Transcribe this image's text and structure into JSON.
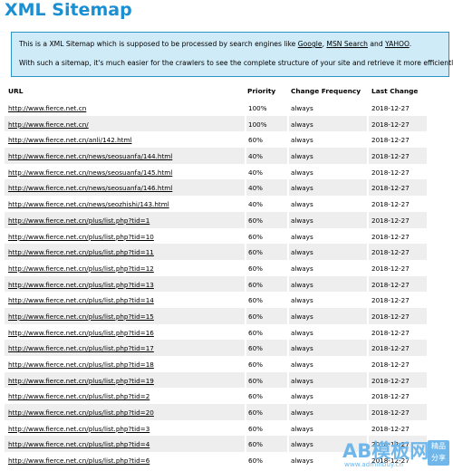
{
  "page": {
    "title": "XML Sitemap"
  },
  "intro": {
    "line1_prefix": "This is a XML Sitemap which is supposed to be processed by search engines like ",
    "link_google": "Google",
    "sep1": ", ",
    "link_msn": "MSN Search",
    "sep2": " and ",
    "link_yahoo": "YAHOO",
    "line1_suffix": ".",
    "line2": "With such a sitemap, it's much easier for the crawlers to see the complete structure of your site and retrieve it more efficiently."
  },
  "table": {
    "headers": {
      "url": "URL",
      "priority": "Priority",
      "frequency": "Change Frequency",
      "modified": "Last Change"
    },
    "rows": [
      {
        "url": "http://www.fierce.net.cn",
        "priority": "100%",
        "frequency": "always",
        "modified": "2018-12-27"
      },
      {
        "url": "http://www.fierce.net.cn/",
        "priority": "100%",
        "frequency": "always",
        "modified": "2018-12-27"
      },
      {
        "url": "http://www.fierce.net.cn/anli/142.html",
        "priority": "60%",
        "frequency": "always",
        "modified": "2018-12-27"
      },
      {
        "url": "http://www.fierce.net.cn/news/seosuanfa/144.html",
        "priority": "40%",
        "frequency": "always",
        "modified": "2018-12-27"
      },
      {
        "url": "http://www.fierce.net.cn/news/seosuanfa/145.html",
        "priority": "40%",
        "frequency": "always",
        "modified": "2018-12-27"
      },
      {
        "url": "http://www.fierce.net.cn/news/seosuanfa/146.html",
        "priority": "40%",
        "frequency": "always",
        "modified": "2018-12-27"
      },
      {
        "url": "http://www.fierce.net.cn/news/seozhishi/143.html",
        "priority": "40%",
        "frequency": "always",
        "modified": "2018-12-27"
      },
      {
        "url": "http://www.fierce.net.cn/plus/list.php?tid=1",
        "priority": "60%",
        "frequency": "always",
        "modified": "2018-12-27"
      },
      {
        "url": "http://www.fierce.net.cn/plus/list.php?tid=10",
        "priority": "60%",
        "frequency": "always",
        "modified": "2018-12-27"
      },
      {
        "url": "http://www.fierce.net.cn/plus/list.php?tid=11",
        "priority": "60%",
        "frequency": "always",
        "modified": "2018-12-27"
      },
      {
        "url": "http://www.fierce.net.cn/plus/list.php?tid=12",
        "priority": "60%",
        "frequency": "always",
        "modified": "2018-12-27"
      },
      {
        "url": "http://www.fierce.net.cn/plus/list.php?tid=13",
        "priority": "60%",
        "frequency": "always",
        "modified": "2018-12-27"
      },
      {
        "url": "http://www.fierce.net.cn/plus/list.php?tid=14",
        "priority": "60%",
        "frequency": "always",
        "modified": "2018-12-27"
      },
      {
        "url": "http://www.fierce.net.cn/plus/list.php?tid=15",
        "priority": "60%",
        "frequency": "always",
        "modified": "2018-12-27"
      },
      {
        "url": "http://www.fierce.net.cn/plus/list.php?tid=16",
        "priority": "60%",
        "frequency": "always",
        "modified": "2018-12-27"
      },
      {
        "url": "http://www.fierce.net.cn/plus/list.php?tid=17",
        "priority": "60%",
        "frequency": "always",
        "modified": "2018-12-27"
      },
      {
        "url": "http://www.fierce.net.cn/plus/list.php?tid=18",
        "priority": "60%",
        "frequency": "always",
        "modified": "2018-12-27"
      },
      {
        "url": "http://www.fierce.net.cn/plus/list.php?tid=19",
        "priority": "60%",
        "frequency": "always",
        "modified": "2018-12-27"
      },
      {
        "url": "http://www.fierce.net.cn/plus/list.php?tid=2",
        "priority": "60%",
        "frequency": "always",
        "modified": "2018-12-27"
      },
      {
        "url": "http://www.fierce.net.cn/plus/list.php?tid=20",
        "priority": "60%",
        "frequency": "always",
        "modified": "2018-12-27"
      },
      {
        "url": "http://www.fierce.net.cn/plus/list.php?tid=3",
        "priority": "60%",
        "frequency": "always",
        "modified": "2018-12-27"
      },
      {
        "url": "http://www.fierce.net.cn/plus/list.php?tid=4",
        "priority": "60%",
        "frequency": "always",
        "modified": "2018-12-27"
      },
      {
        "url": "http://www.fierce.net.cn/plus/list.php?tid=6",
        "priority": "60%",
        "frequency": "always",
        "modified": "2018-12-27"
      }
    ]
  },
  "watermark": {
    "brand": "AB模板网",
    "badge_line1": "精品",
    "badge_line2": "分享",
    "url": "www.adminbuy.cn"
  },
  "colors": {
    "title": "#1a8fd1",
    "intro_bg": "#cfebf7",
    "intro_border": "#2a93c9",
    "row_alt": "#eeeeee",
    "watermark": "#6fb7ea"
  }
}
